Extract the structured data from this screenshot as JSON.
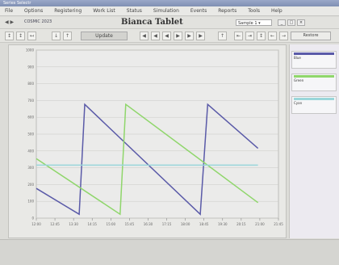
{
  "window": {
    "title": "Series Selectr"
  },
  "menu": [
    "File",
    "Options",
    "Registering",
    "Work List",
    "Status",
    "Simulation",
    "Events",
    "Reports",
    "Tools",
    "Help"
  ],
  "header": {
    "title": "Bianca Tablet",
    "session": "COSMIC 2023",
    "nav": "◀ ▶",
    "search_value": "Sample 1   ▾"
  },
  "toolbar": {
    "buttons_left": [
      "↕",
      "↕",
      "↤",
      "↓",
      "↑"
    ],
    "play_label": "Update",
    "buttons_mid": [
      "◀",
      "◀",
      "◀",
      "▶",
      "▶",
      "▶"
    ],
    "buttons_right": [
      "↑",
      "⇤",
      "⇥",
      "↕",
      "←",
      "→"
    ],
    "restore_label": "Restore"
  },
  "colors": {
    "blue": "#5a5aa8",
    "green": "#8fd66b",
    "cyan": "#9ad6da",
    "grid": "#c9c9c5"
  },
  "chart_data": {
    "type": "line",
    "title": "",
    "xlabel": "",
    "ylabel": "",
    "ylim": [
      0,
      13
    ],
    "xlim": [
      0,
      13
    ],
    "y_ticks": [
      "1000",
      "900",
      "800",
      "700",
      "600",
      "500",
      "400",
      "300",
      "200",
      "100",
      "0"
    ],
    "x_ticks": [
      "12:00",
      "12:45",
      "13:30",
      "14:15",
      "15:00",
      "15:45",
      "16:30",
      "17:15",
      "18:00",
      "18:45",
      "19:30",
      "20:15",
      "21:00",
      "21:45"
    ],
    "series": [
      {
        "name": "",
        "color": "#5a5aa8",
        "x": [
          0,
          2.3,
          2.6,
          8.8,
          9.2,
          11.9
        ],
        "y": [
          2.3,
          0.3,
          8.8,
          0.3,
          8.8,
          5.4
        ]
      },
      {
        "name": "",
        "color": "#8fd66b",
        "x": [
          0,
          4.5,
          4.8,
          11.9
        ],
        "y": [
          4.6,
          0.3,
          8.8,
          1.2
        ]
      },
      {
        "name": "",
        "color": "#9ad6da",
        "x": [
          0,
          11.9
        ],
        "y": [
          4.1,
          4.1
        ]
      }
    ]
  },
  "side_panel": {
    "cards": [
      {
        "line1": "Blue"
      },
      {
        "line1": "Green"
      },
      {
        "line1": "Cyan"
      }
    ]
  }
}
